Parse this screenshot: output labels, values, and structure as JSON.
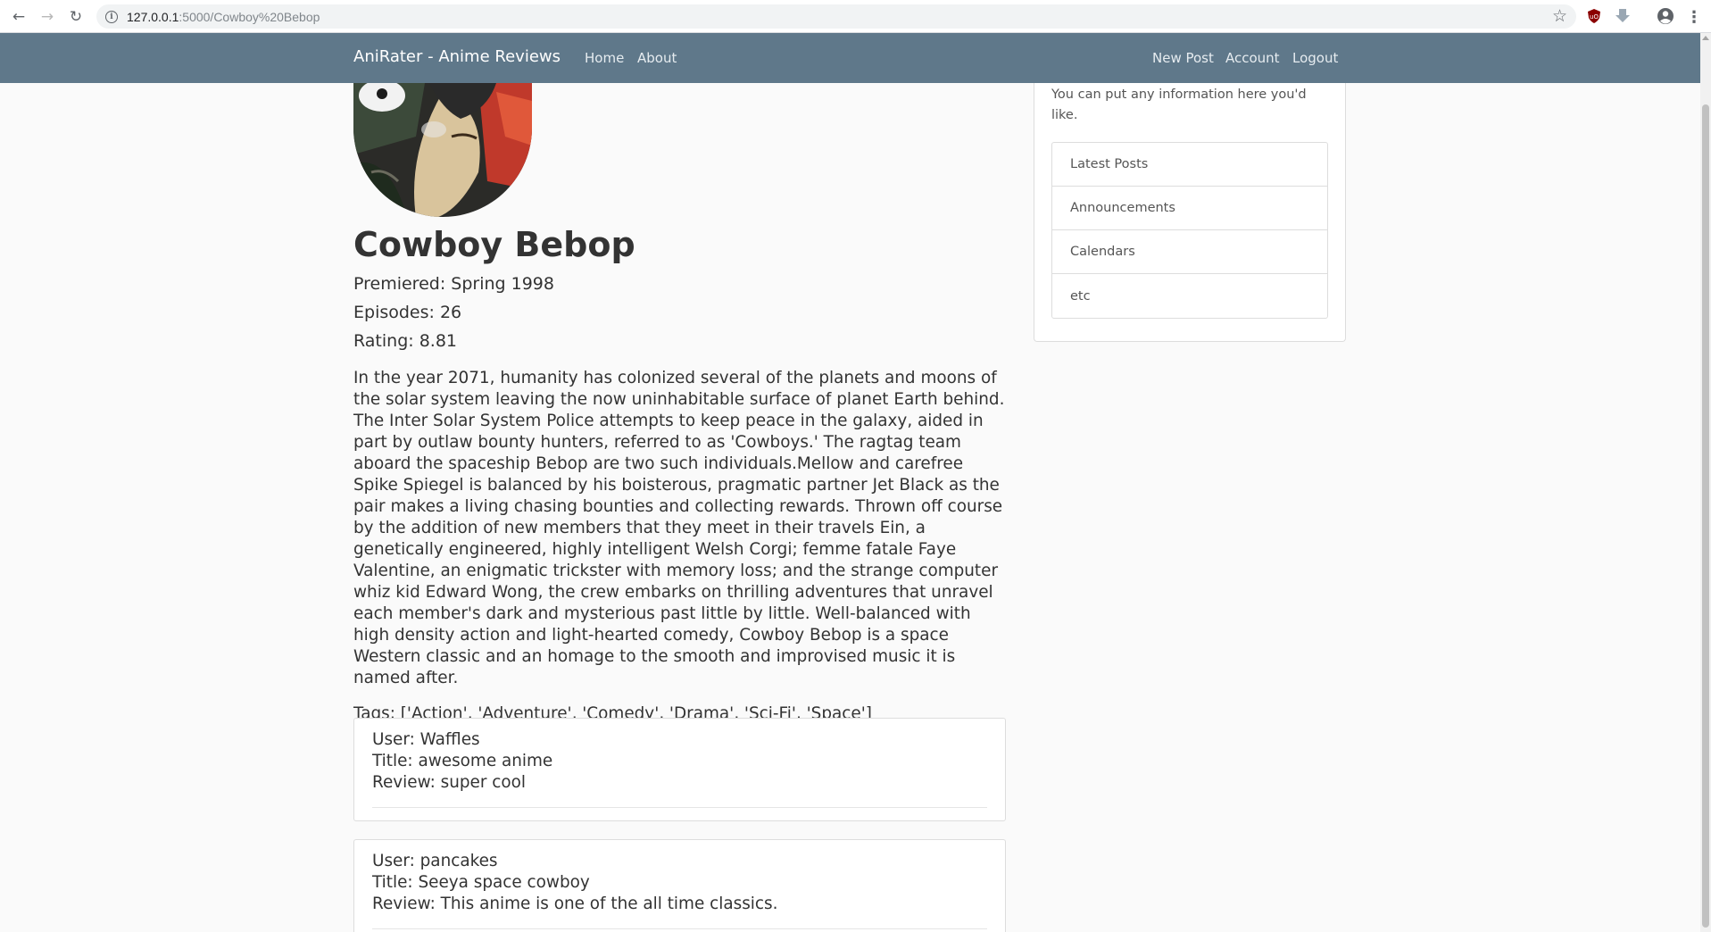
{
  "browser": {
    "url_host": "127.0.0.1",
    "url_path": ":5000/Cowboy%20Bebop"
  },
  "navbar": {
    "brand": "AniRater - Anime Reviews",
    "left_links": [
      "Home",
      "About"
    ],
    "right_links": [
      "New Post",
      "Account",
      "Logout"
    ]
  },
  "anime": {
    "title": "Cowboy Bebop",
    "premiered": "Premiered: Spring 1998",
    "episodes": "Episodes: 26",
    "rating": "Rating: 8.81",
    "synopsis": "In the year 2071, humanity has colonized several of the planets and moons of the solar system leaving the now uninhabitable surface of planet Earth behind. The Inter Solar System Police attempts to keep peace in the galaxy, aided in part by outlaw bounty hunters, referred to as 'Cowboys.' The ragtag team aboard the spaceship Bebop are two such individuals.Mellow and carefree Spike Spiegel is balanced by his boisterous, pragmatic partner Jet Black as the pair makes a living chasing bounties and collecting rewards. Thrown off course by the addition of new members that they meet in their travels Ein, a genetically engineered, highly intelligent Welsh Corgi; femme fatale Faye Valentine, an enigmatic trickster with memory loss; and the strange computer whiz kid Edward Wong, the crew embarks on thrilling adventures that unravel each member's dark and mysterious past little by little. Well-balanced with high density action and light-hearted comedy, Cowboy Bebop is a space Western classic and an homage to the smooth and improvised music it is named after.",
    "tags": "Tags: ['Action', 'Adventure', 'Comedy', 'Drama', 'Sci-Fi', 'Space']"
  },
  "reviews": [
    {
      "user": "User: Waffles",
      "title": "Title: awesome anime",
      "review": "Review: super cool"
    },
    {
      "user": "User: pancakes",
      "title": "Title: Seeya space cowboy",
      "review": "Review: This anime is one of the all time classics."
    }
  ],
  "sidebar": {
    "text": "You can put any information here you'd like.",
    "items": [
      "Latest Posts",
      "Announcements",
      "Calendars",
      "etc"
    ]
  },
  "colors": {
    "navbar": "#5f788a",
    "page_bg": "#fafafa",
    "text": "#333333"
  }
}
